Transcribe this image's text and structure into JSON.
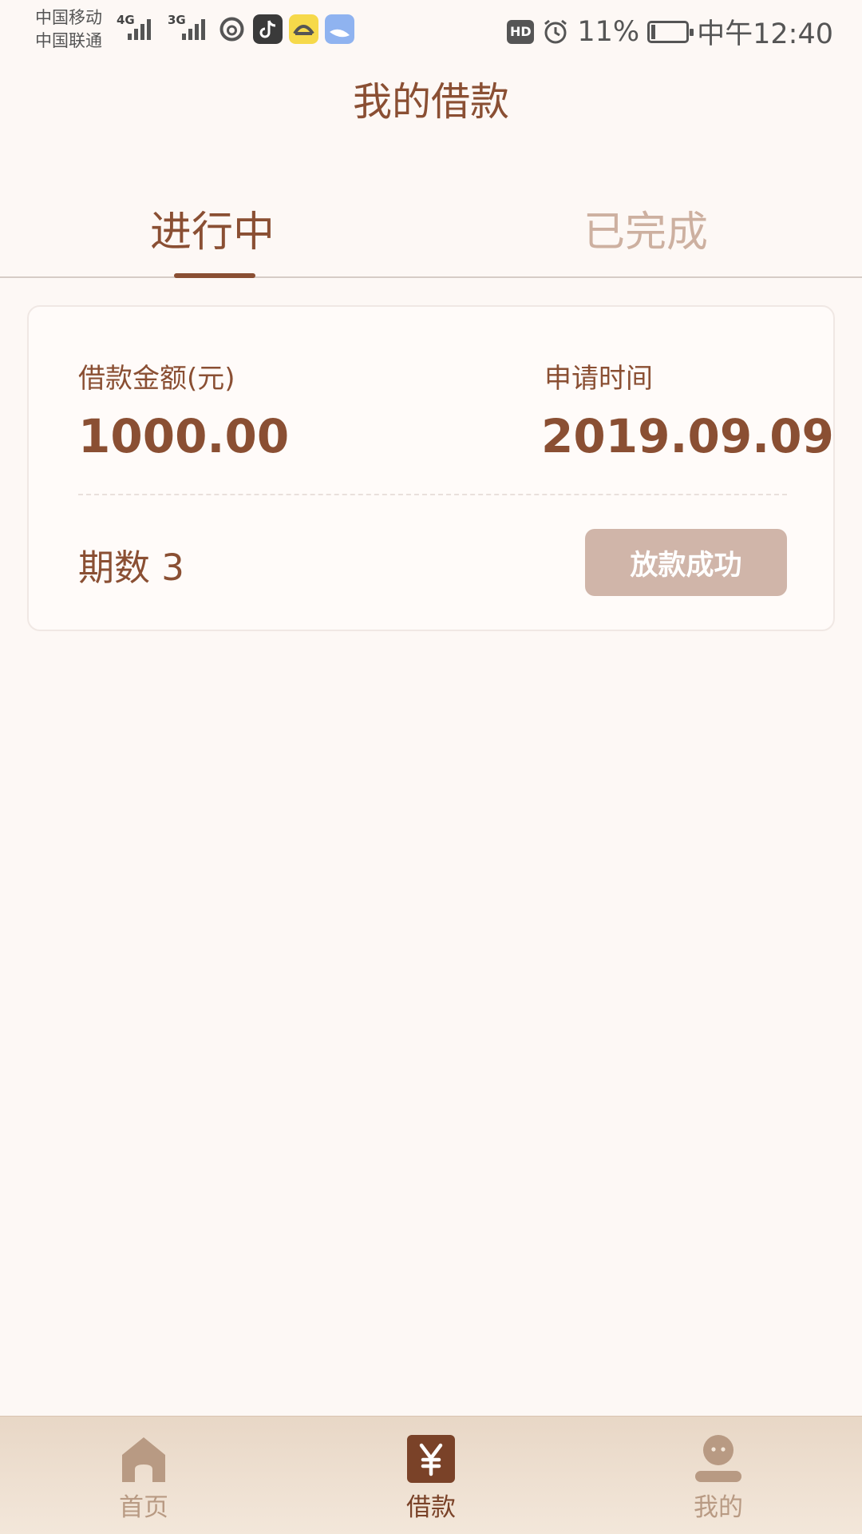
{
  "status_bar": {
    "carrier_1": "中国移动",
    "carrier_2": "中国联通",
    "network_1": "4G",
    "network_2": "3G",
    "hd": "HD",
    "battery_percent": "11%",
    "battery_level": 0.11,
    "time": "中午12:40",
    "app_icons": [
      "netease-music-icon",
      "tiktok-icon",
      "banana-app-icon",
      "whale-browser-icon"
    ]
  },
  "header": {
    "title": "我的借款"
  },
  "tabs": [
    {
      "label": "进行中",
      "active": true
    },
    {
      "label": "已完成",
      "active": false
    }
  ],
  "loan_card": {
    "amount_label": "借款金额(元)",
    "amount_value": "1000.00",
    "time_label": "申请时间",
    "time_value": "2019.09.09",
    "periods_text": "期数 3",
    "status_button": "放款成功"
  },
  "bottom_nav": [
    {
      "label": "首页",
      "icon": "home-icon",
      "active": false
    },
    {
      "label": "借款",
      "icon": "yen-icon",
      "active": true
    },
    {
      "label": "我的",
      "icon": "user-icon",
      "active": false
    }
  ],
  "colors": {
    "primary": "#8a4f33",
    "inactive_tab": "#cdb0a0",
    "button_bg": "#d0b5a9",
    "page_bg": "#fdf8f5"
  }
}
